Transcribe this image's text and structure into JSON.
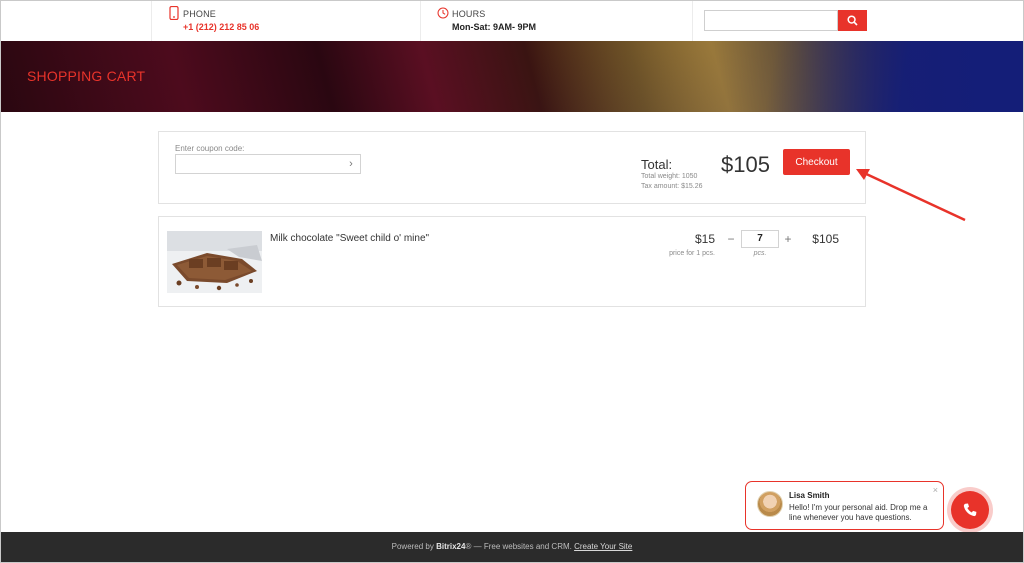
{
  "header": {
    "phone": {
      "label": "PHONE",
      "value": "+1 (212) 212 85 06",
      "icon": "phone-icon"
    },
    "hours": {
      "label": "HOURS",
      "value": "Mon-Sat: 9AM- 9PM",
      "icon": "clock-icon"
    },
    "search": {
      "placeholder": "",
      "button_icon": "search-icon"
    }
  },
  "banner": {
    "title": "SHOPPING CART"
  },
  "cart_summary": {
    "coupon_label": "Enter coupon code:",
    "coupon_value": "",
    "total_label": "Total:",
    "total_weight": "Total weight: 1050",
    "tax_amount": "Tax amount: $15.26",
    "total_value": "$105",
    "checkout_label": "Checkout"
  },
  "items": [
    {
      "name": "Milk chocolate \"Sweet child o' mine\"",
      "unit_price": "$15",
      "unit_price_note": "price for 1 pcs.",
      "quantity": "7",
      "quantity_unit": "pcs.",
      "minus": "−",
      "plus": "+",
      "line_total": "$105"
    }
  ],
  "chat": {
    "agent_name": "Lisa Smith",
    "message": "Hello! I'm your personal aid. Drop me a line whenever you have questions.",
    "close": "×"
  },
  "footer": {
    "powered_by": "Powered by",
    "brand": "Bitrix24",
    "reg": "®",
    "tagline": " — Free websites and CRM.",
    "create_link": "Create Your Site"
  },
  "colors": {
    "accent": "#e8332a",
    "footer_bg": "#2b2b2b"
  }
}
